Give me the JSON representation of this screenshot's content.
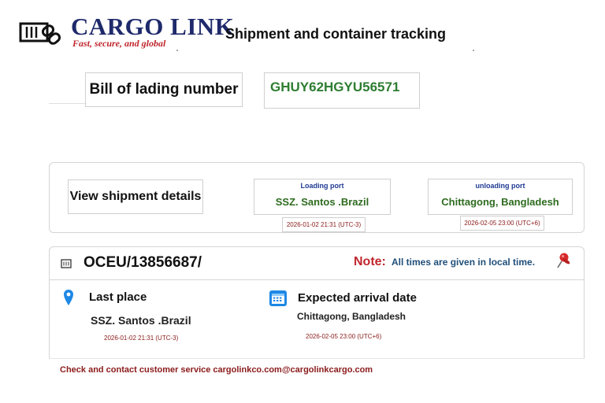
{
  "header": {
    "brand": "CARGO LINK",
    "tagline": "Fast, secure, and global",
    "title": "Shipment and container tracking"
  },
  "bill_of_lading": {
    "label": "Bill of lading number",
    "value": "GHUY62HGYU56571"
  },
  "shipment": {
    "view_label": "View shipment details",
    "loading": {
      "label": "Loading port",
      "port": "SSZ. Santos .Brazil",
      "time": "2026-01-02 21:31 (UTC-3)"
    },
    "unloading": {
      "label": "unloading port",
      "port": "Chittagong, Bangladesh",
      "time": "2026-02-05 23:00 (UTC+6)"
    }
  },
  "container": {
    "number": "OCEU/13856687/",
    "note_label": "Note:",
    "note_text": "All times are given in local time.",
    "last_place": {
      "label": "Last place",
      "value": "SSZ. Santos .Brazil",
      "time": "2026-01-02 21:31 (UTC-3)"
    },
    "eta": {
      "label": "Expected arrival date",
      "value": "Chittagong, Bangladesh",
      "time": "2026-02-05 23:00 (UTC+6)"
    }
  },
  "footer": {
    "contact": "Check and contact customer service cargolinkco.com@cargolinkcargo.com"
  },
  "colors": {
    "brand": "#1f2a6b",
    "accent_red": "#c0262d",
    "value_green": "#2e7d32",
    "time_red": "#8b1a1a"
  },
  "icons": [
    "container-link-logo-icon",
    "container-icon",
    "pushpin-icon",
    "location-pin-icon",
    "calendar-icon"
  ]
}
